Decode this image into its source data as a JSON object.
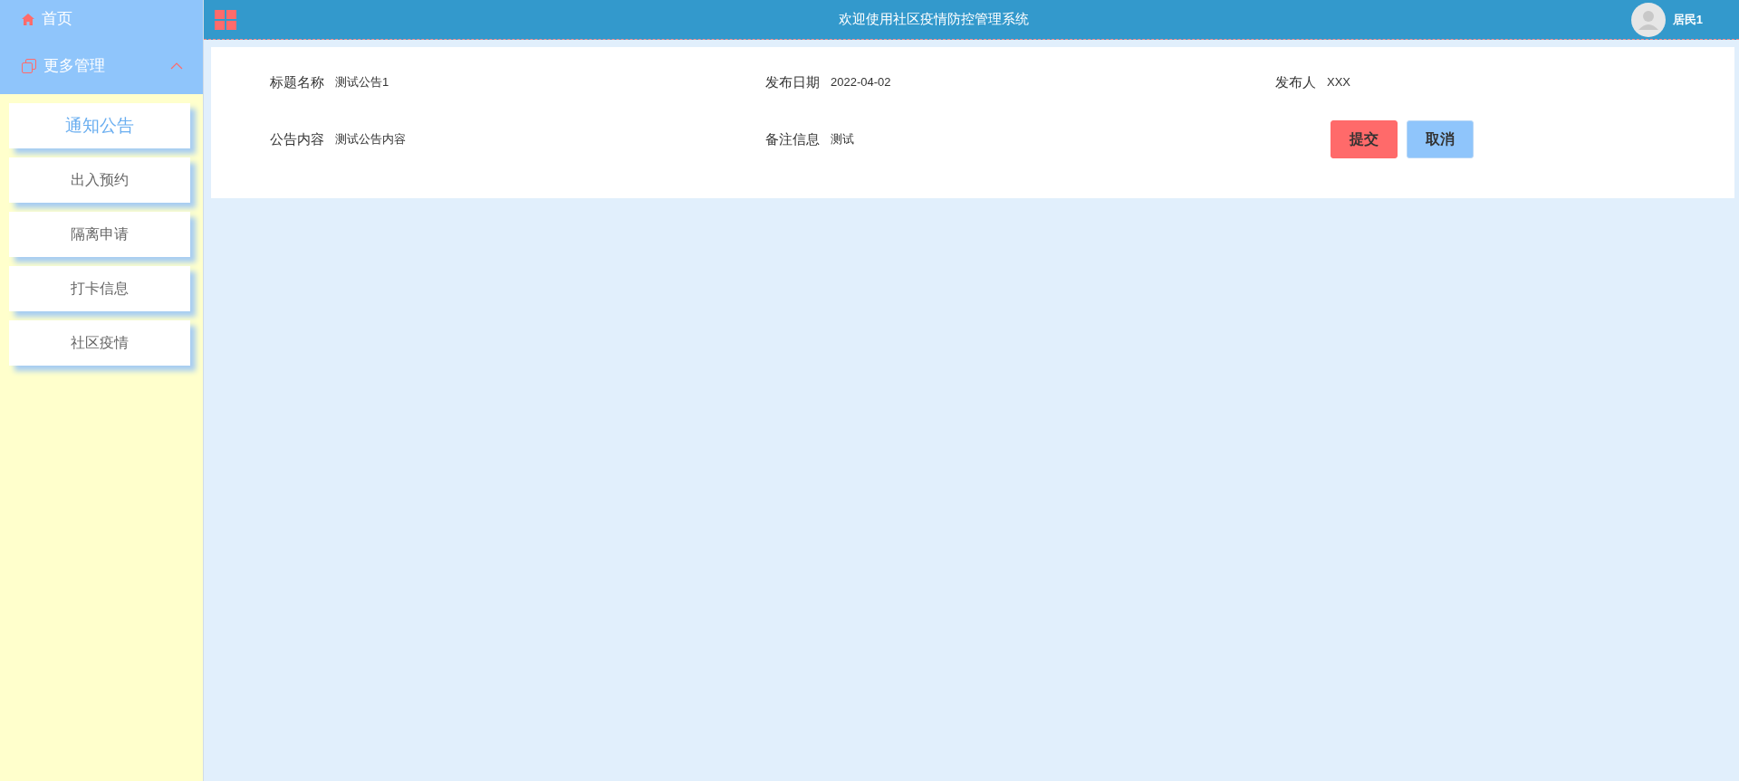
{
  "sidebar": {
    "items": [
      {
        "kind": "link",
        "label": "首页"
      },
      {
        "kind": "group",
        "label": "更多管理",
        "expanded": true,
        "children": [
          {
            "label": "通知公告",
            "selected": true
          },
          {
            "label": "出入预约",
            "selected": false
          },
          {
            "label": "隔离申请",
            "selected": false
          },
          {
            "label": "打卡信息",
            "selected": false
          },
          {
            "label": "社区疫情",
            "selected": false
          }
        ]
      }
    ]
  },
  "header": {
    "title": "欢迎使用社区疫情防控管理系统",
    "user": "居民1"
  },
  "form": {
    "fields": [
      {
        "label": "标题名称",
        "value": "测试公告1"
      },
      {
        "label": "发布日期",
        "value": "2022-04-02"
      },
      {
        "label": "发布人",
        "value": "XXX"
      },
      {
        "label": "公告内容",
        "value": "测试公告内容"
      },
      {
        "label": "备注信息",
        "value": "测试"
      }
    ],
    "buttons": [
      {
        "kind": "primary",
        "label": "提交"
      },
      {
        "kind": "secondary",
        "label": "取消"
      }
    ]
  }
}
